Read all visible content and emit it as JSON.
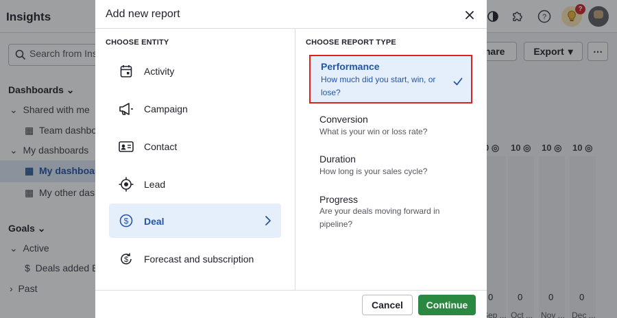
{
  "app": {
    "title": "Insights",
    "notification_count": "?"
  },
  "sidebar": {
    "search_placeholder": "Search from Insights",
    "dashboards_heading": "Dashboards",
    "shared_with_me": "Shared with me",
    "team_dashboard": "Team dashboard",
    "my_dashboards": "My dashboards",
    "my_dashboard": "My dashboard",
    "my_other_dashboard": "My other dashboard",
    "goals_heading": "Goals",
    "active": "Active",
    "deals_added": "Deals added By",
    "past": "Past"
  },
  "dashboard": {
    "share_label": "Share",
    "export_label": "Export",
    "more_label": "⋯",
    "targets": [
      "0",
      "10",
      "10",
      "10"
    ],
    "zeros": [
      "0",
      "0",
      "0",
      "0"
    ],
    "months": [
      "Sep ...",
      "Oct ...",
      "Nov ...",
      "Dec ..."
    ]
  },
  "modal": {
    "title": "Add new report",
    "entity_heading": "CHOOSE ENTITY",
    "report_heading": "CHOOSE REPORT TYPE",
    "entities": [
      {
        "label": "Activity",
        "icon": "calendar-icon"
      },
      {
        "label": "Campaign",
        "icon": "megaphone-icon"
      },
      {
        "label": "Contact",
        "icon": "contact-card-icon"
      },
      {
        "label": "Lead",
        "icon": "target-icon"
      },
      {
        "label": "Deal",
        "icon": "dollar-circle-icon",
        "selected": true
      },
      {
        "label": "Forecast and subscription",
        "icon": "dollar-refresh-icon"
      }
    ],
    "report_types": [
      {
        "title": "Performance",
        "description": "How much did you start, win, or lose?",
        "selected": true
      },
      {
        "title": "Conversion",
        "description": "What is your win or loss rate?"
      },
      {
        "title": "Duration",
        "description": "How long is your sales cycle?"
      },
      {
        "title": "Progress",
        "description": "Are your deals moving forward in pipeline?"
      }
    ],
    "cancel_label": "Cancel",
    "continue_label": "Continue"
  },
  "colors": {
    "accent_blue": "#2355a8",
    "selection_bg": "#e5eefb",
    "highlight_red": "#e0201a",
    "continue_green": "#2a8841"
  }
}
